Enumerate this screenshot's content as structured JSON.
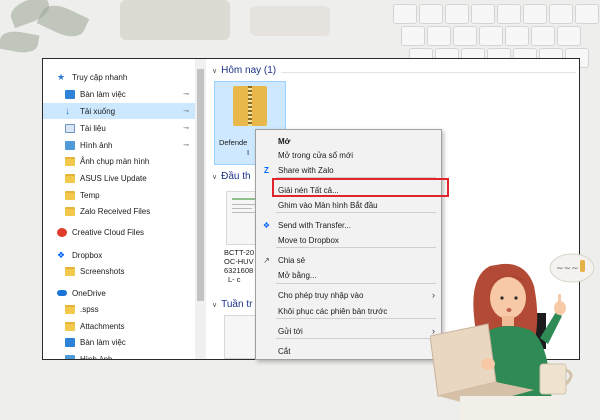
{
  "nav": {
    "items": [
      {
        "label": "Truy cập nhanh",
        "icon": "star-icon",
        "pinned": false
      },
      {
        "label": "Bàn làm việc",
        "icon": "desktop-icon",
        "pinned": true
      },
      {
        "label": "Tải xuống",
        "icon": "download-icon",
        "pinned": true,
        "selected": true
      },
      {
        "label": "Tài liệu",
        "icon": "document-icon",
        "pinned": true
      },
      {
        "label": "Hình ảnh",
        "icon": "picture-icon",
        "pinned": true
      },
      {
        "label": "Ảnh chụp màn hình",
        "icon": "folder-icon",
        "pinned": false
      },
      {
        "label": "ASUS Live Update",
        "icon": "folder-icon",
        "pinned": false
      },
      {
        "label": "Temp",
        "icon": "folder-icon",
        "pinned": false
      },
      {
        "label": "Zalo Received Files",
        "icon": "folder-icon",
        "pinned": false
      },
      {
        "label": "Creative Cloud Files",
        "icon": "creative-cloud-icon",
        "pinned": false
      },
      {
        "label": "Dropbox",
        "icon": "dropbox-icon",
        "pinned": false
      },
      {
        "label": "Screenshots",
        "icon": "folder-icon",
        "pinned": false
      },
      {
        "label": "OneDrive",
        "icon": "onedrive-icon",
        "pinned": false
      },
      {
        "label": ".spss",
        "icon": "folder-icon",
        "pinned": false
      },
      {
        "label": "Attachments",
        "icon": "folder-icon",
        "pinned": false
      },
      {
        "label": "Bàn làm việc",
        "icon": "desktop-icon",
        "pinned": false
      },
      {
        "label": "Hình ảnh",
        "icon": "picture-icon",
        "pinned": false
      }
    ]
  },
  "content": {
    "groups": {
      "today": "Hôm nay (1)",
      "early": "Đầu th",
      "week": "Tuần tr"
    },
    "zip_file": {
      "line1": "Defende",
      "line2": "I"
    },
    "doc_file": {
      "line1": "BCTT-20",
      "line2": "OC-HUV",
      "line3": "6321608",
      "line4": "L- c"
    }
  },
  "menu": {
    "items": [
      {
        "label": "Mở",
        "bold": true,
        "icon": "",
        "submenu": false
      },
      {
        "label": "Mở trong cửa sổ mới",
        "icon": "",
        "submenu": false
      },
      {
        "label": "Share with Zalo",
        "icon": "zalo-icon",
        "submenu": false
      },
      {
        "label": "Giải nén Tất cả...",
        "icon": "",
        "submenu": false
      },
      {
        "label": "Ghim vào Màn hình Bắt đầu",
        "icon": "",
        "submenu": false
      },
      {
        "label": "Send with Transfer...",
        "icon": "dropbox-icon",
        "submenu": false
      },
      {
        "label": "Move to Dropbox",
        "icon": "",
        "submenu": false
      },
      {
        "label": "Chia sẻ",
        "icon": "share-icon",
        "submenu": false
      },
      {
        "label": "Mở bằng...",
        "icon": "",
        "submenu": false
      },
      {
        "label": "Cho phép truy nhập vào",
        "icon": "",
        "submenu": true
      },
      {
        "label": "Khôi phục các phiên bản trước",
        "icon": "",
        "submenu": false
      },
      {
        "label": "Gửi tới",
        "icon": "",
        "submenu": true
      },
      {
        "label": "Cắt",
        "icon": "",
        "submenu": false
      }
    ]
  },
  "colors": {
    "highlight": "#e0262b",
    "selection": "#cce8ff",
    "folder": "#f3c94c",
    "group_header": "#1e3287"
  }
}
